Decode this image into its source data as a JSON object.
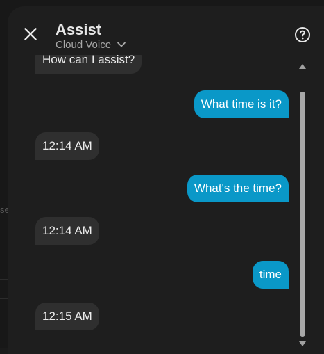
{
  "backdrop": {
    "text_fragment": "se"
  },
  "dialog": {
    "title": "Assist",
    "pipeline_label": "Cloud Voice",
    "icons": {
      "close": "close-icon",
      "help": "help-icon",
      "dropdown": "chevron-down-icon"
    }
  },
  "conversation": {
    "messages": [
      {
        "role": "assistant",
        "text": "How can I assist?"
      },
      {
        "role": "user",
        "text": "What time is it?"
      },
      {
        "role": "assistant",
        "text": "12:14 AM"
      },
      {
        "role": "user",
        "text": "What's the time?"
      },
      {
        "role": "assistant",
        "text": "12:14 AM"
      },
      {
        "role": "user",
        "text": "time"
      },
      {
        "role": "assistant",
        "text": "12:15 AM"
      }
    ]
  },
  "colors": {
    "user_bubble": "#0a98c8",
    "assistant_bubble": "#2f2f2f",
    "dialog_background": "#1e1e1e"
  }
}
